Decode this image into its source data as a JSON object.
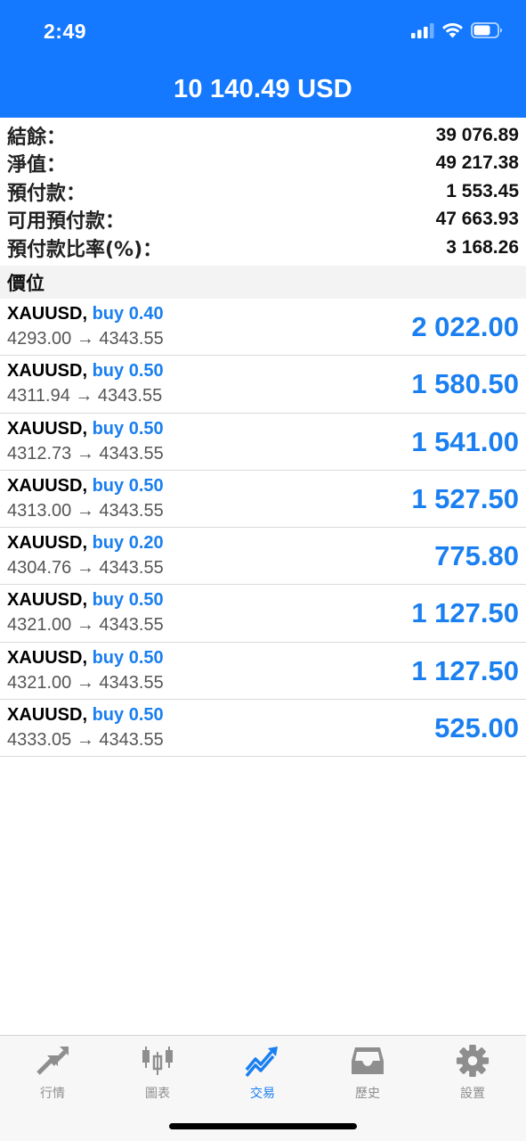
{
  "status_bar": {
    "time": "2:49"
  },
  "header": {
    "title": "10 140.49 USD"
  },
  "summary": [
    {
      "label": "結餘：",
      "value": "39 076.89"
    },
    {
      "label": "淨值：",
      "value": "49 217.38"
    },
    {
      "label": "預付款：",
      "value": "1 553.45"
    },
    {
      "label": "可用預付款：",
      "value": "47 663.93"
    },
    {
      "label": "預付款比率(%)：",
      "value": "3 168.26"
    }
  ],
  "positions_section": {
    "title": "價位"
  },
  "positions": [
    {
      "symbol": "XAUUSD,",
      "side": "buy 0.40",
      "prices": "4293.00 → 4343.55",
      "profit": "2 022.00"
    },
    {
      "symbol": "XAUUSD,",
      "side": "buy 0.50",
      "prices": "4311.94 → 4343.55",
      "profit": "1 580.50"
    },
    {
      "symbol": "XAUUSD,",
      "side": "buy 0.50",
      "prices": "4312.73 → 4343.55",
      "profit": "1 541.00"
    },
    {
      "symbol": "XAUUSD,",
      "side": "buy 0.50",
      "prices": "4313.00 → 4343.55",
      "profit": "1 527.50"
    },
    {
      "symbol": "XAUUSD,",
      "side": "buy 0.20",
      "prices": "4304.76 → 4343.55",
      "profit": "775.80"
    },
    {
      "symbol": "XAUUSD,",
      "side": "buy 0.50",
      "prices": "4321.00 → 4343.55",
      "profit": "1 127.50"
    },
    {
      "symbol": "XAUUSD,",
      "side": "buy 0.50",
      "prices": "4321.00 → 4343.55",
      "profit": "1 127.50"
    },
    {
      "symbol": "XAUUSD,",
      "side": "buy 0.50",
      "prices": "4333.05 → 4343.55",
      "profit": "525.00"
    }
  ],
  "tabbar": {
    "tabs": [
      {
        "label": "行情",
        "icon": "quotes-arrows-icon",
        "active": false
      },
      {
        "label": "圖表",
        "icon": "candlestick-chart-icon",
        "active": false
      },
      {
        "label": "交易",
        "icon": "trade-trend-icon",
        "active": true
      },
      {
        "label": "歷史",
        "icon": "history-inbox-icon",
        "active": false
      },
      {
        "label": "設置",
        "icon": "gear-icon",
        "active": false
      }
    ]
  },
  "colors": {
    "accent": "#1479ff",
    "profit": "#1a7ff0",
    "inactive_tab": "#8e8e8e"
  }
}
